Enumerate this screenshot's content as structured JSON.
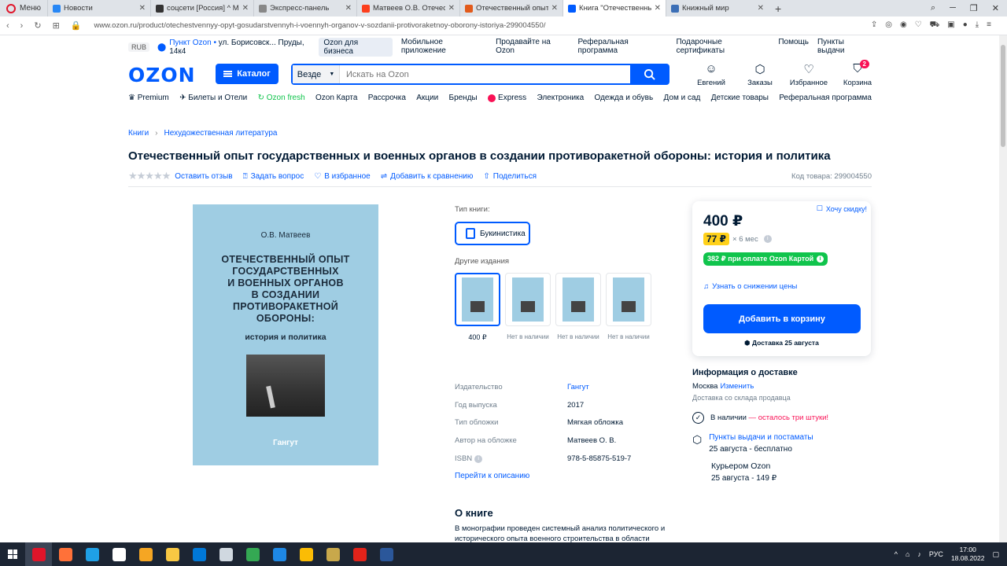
{
  "browser": {
    "menu_label": "Меню",
    "tabs": [
      {
        "title": "Новости",
        "color": "#2787f5",
        "active": false
      },
      {
        "title": "соцсети [Россия] ^ Media",
        "color": "#333333",
        "active": false
      },
      {
        "title": "Экспресс-панель",
        "color": "#888888",
        "active": false
      },
      {
        "title": "Матвеев О.В. Отечествен",
        "color": "#fc3f1d",
        "active": false
      },
      {
        "title": "Отечественный опыт госу",
        "color": "#e25b1c",
        "active": false
      },
      {
        "title": "Книга \"Отечественный оп",
        "color": "#005bff",
        "active": true
      },
      {
        "title": "Книжный мир",
        "color": "#3c6fb6",
        "active": false
      }
    ],
    "url": "www.ozon.ru/product/otechestvennyy-opyt-gosudarstvennyh-i-voennyh-organov-v-sozdanii-protivoraketnoy-oborony-istoriya-299004550/"
  },
  "topline": {
    "currency": "RUB",
    "pickup_prefix": "Пункт Ozon • ",
    "pickup_address": "ул. Борисовск... Пруды, 14к4",
    "links": [
      "Ozon для бизнеса",
      "Мобильное приложение",
      "Продавайте на Ozon",
      "Реферальная программа",
      "Подарочные сертификаты",
      "Помощь",
      "Пункты выдачи"
    ]
  },
  "header": {
    "logo": "OZON",
    "catalog_label": "Каталог",
    "search_scope": "Везде",
    "search_placeholder": "Искать на Ozon",
    "user": {
      "label": "Евгений"
    },
    "orders": {
      "label": "Заказы"
    },
    "favorites": {
      "label": "Избранное"
    },
    "cart": {
      "label": "Корзина",
      "count": "2"
    }
  },
  "nav": {
    "premium": "Premium",
    "tickets": "Билеты и Отели",
    "fresh": "Ozon fresh",
    "card": "Ozon Карта",
    "installment": "Рассрочка",
    "promos": "Акции",
    "brands": "Бренды",
    "express": "Express",
    "electronics": "Электроника",
    "clothes": "Одежда и обувь",
    "home": "Дом и сад",
    "kids": "Детские товары",
    "referral": "Реферальная программа"
  },
  "breadcrumbs": [
    "Книги",
    "Нехудожественная литература"
  ],
  "product": {
    "title": "Отечественный опыт государственных и военных органов в создании противоракетной обороны: история и политика",
    "actions": {
      "review": "Оставить отзыв",
      "question": "Задать вопрос",
      "favorite": "В избранное",
      "compare": "Добавить к сравнению",
      "share": "Поделиться"
    },
    "sku": "Код товара: 299004550",
    "cover": {
      "author": "О.В. Матвеев",
      "title_lines": [
        "ОТЕЧЕСТВЕННЫЙ ОПЫТ",
        "ГОСУДАРСТВЕННЫХ",
        "И ВОЕННЫХ ОРГАНОВ",
        "В СОЗДАНИИ",
        "ПРОТИВОРАКЕТНОЙ",
        "ОБОРОНЫ:"
      ],
      "subtitle": "история и политика",
      "publisher": "Гангут"
    },
    "book_type_label": "Тип книги:",
    "book_type": "Букинистика",
    "other_editions_label": "Другие издания",
    "editions": [
      {
        "label": "400 ₽",
        "selected": true
      },
      {
        "label": "Нет в наличии",
        "selected": false
      },
      {
        "label": "Нет в наличии",
        "selected": false
      },
      {
        "label": "Нет в наличии",
        "selected": false
      }
    ],
    "specs": [
      {
        "key": "Издательство",
        "value": "Гангут",
        "link": true,
        "info": false
      },
      {
        "key": "Год выпуска",
        "value": "2017",
        "link": false,
        "info": false
      },
      {
        "key": "Тип обложки",
        "value": "Мягкая обложка",
        "link": false,
        "info": false
      },
      {
        "key": "Автор на обложке",
        "value": "Матвеев О. В.",
        "link": false,
        "info": false
      },
      {
        "key": "ISBN",
        "value": "978-5-85875-519-7",
        "link": false,
        "info": true
      }
    ],
    "goto_description": "Перейти к описанию",
    "about_heading": "О книге",
    "about_text": "В монографии проведен системный анализ политического и исторического опыта военного строительства в области"
  },
  "price_box": {
    "price": "400 ₽",
    "want_discount": "Хочу скидку!",
    "installment_amount": "77 ₽",
    "installment_term": "× 6 мес",
    "card_price": "382 ₽ при оплате Ozon Картой",
    "notify": "Узнать о снижении цены",
    "add_to_cart": "Добавить в корзину",
    "delivery": "Доставка 25 августа"
  },
  "delivery_info": {
    "heading": "Информация о доставке",
    "city": "Москва",
    "change": "Изменить",
    "warehouse": "Доставка со склада продавца",
    "in_stock": "В наличии",
    "stock_left": " — осталось три штуки!",
    "pickup_title": "Пункты выдачи и постаматы",
    "pickup_detail": "25 августа - бесплатно",
    "courier_title": "Курьером Ozon",
    "courier_detail": "25 августа - 149 ₽"
  },
  "taskbar": {
    "apps": [
      {
        "name": "opera",
        "color": "#e0152a",
        "active": true
      },
      {
        "name": "firefox",
        "color": "#ff7139",
        "active": false
      },
      {
        "name": "edge",
        "color": "#1fa0e6",
        "active": false
      },
      {
        "name": "yandex",
        "color": "#ffffff",
        "active": false
      },
      {
        "name": "app-ic",
        "color": "#f5a623",
        "active": false
      },
      {
        "name": "folder",
        "color": "#f8c843",
        "active": false
      },
      {
        "name": "mail",
        "color": "#0078d7",
        "active": false
      },
      {
        "name": "bluetooth-pc",
        "color": "#d0d8e0",
        "active": false
      },
      {
        "name": "chrome-like",
        "color": "#34a853",
        "active": false
      },
      {
        "name": "ie",
        "color": "#1e88e5",
        "active": false
      },
      {
        "name": "chrome",
        "color": "#fbbc05",
        "active": false
      },
      {
        "name": "archive",
        "color": "#c8a84b",
        "active": false
      },
      {
        "name": "acrobat",
        "color": "#e2231a",
        "active": false
      },
      {
        "name": "word",
        "color": "#2b579a",
        "active": false
      }
    ],
    "lang": "РУС",
    "time": "17:00",
    "date": "18.08.2022"
  }
}
